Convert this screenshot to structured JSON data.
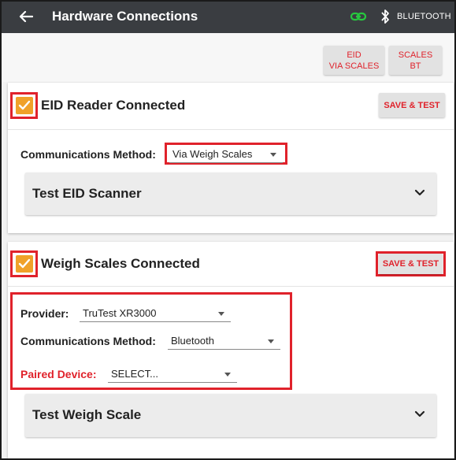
{
  "appbar": {
    "title": "Hardware Connections",
    "bluetooth_label": "BLUETOOTH",
    "icons": [
      "back-arrow-icon",
      "link-icon",
      "bluetooth-icon"
    ],
    "connected_color": "#27c93f"
  },
  "top_buttons": {
    "eid_via_scales": "EID\nVIA SCALES",
    "scales_bt": "SCALES\nBT"
  },
  "eid_card": {
    "checked": true,
    "title": "EID Reader Connected",
    "save_test": "SAVE & TEST",
    "comm_label": "Communications Method:",
    "comm_value": "Via Weigh Scales",
    "test_title": "Test EID Scanner"
  },
  "scales_card": {
    "checked": true,
    "title": "Weigh Scales Connected",
    "save_test": "SAVE & TEST",
    "provider_label": "Provider:",
    "provider_value": "TruTest XR3000",
    "comm_label": "Communications Method:",
    "comm_value": "Bluetooth",
    "paired_label": "Paired Device:",
    "paired_value": "SELECT...",
    "test_title": "Test Weigh Scale"
  },
  "colors": {
    "accent_red": "#e0222b",
    "checkbox_orange": "#f0a129",
    "appbar_bg": "#3a3d41"
  }
}
